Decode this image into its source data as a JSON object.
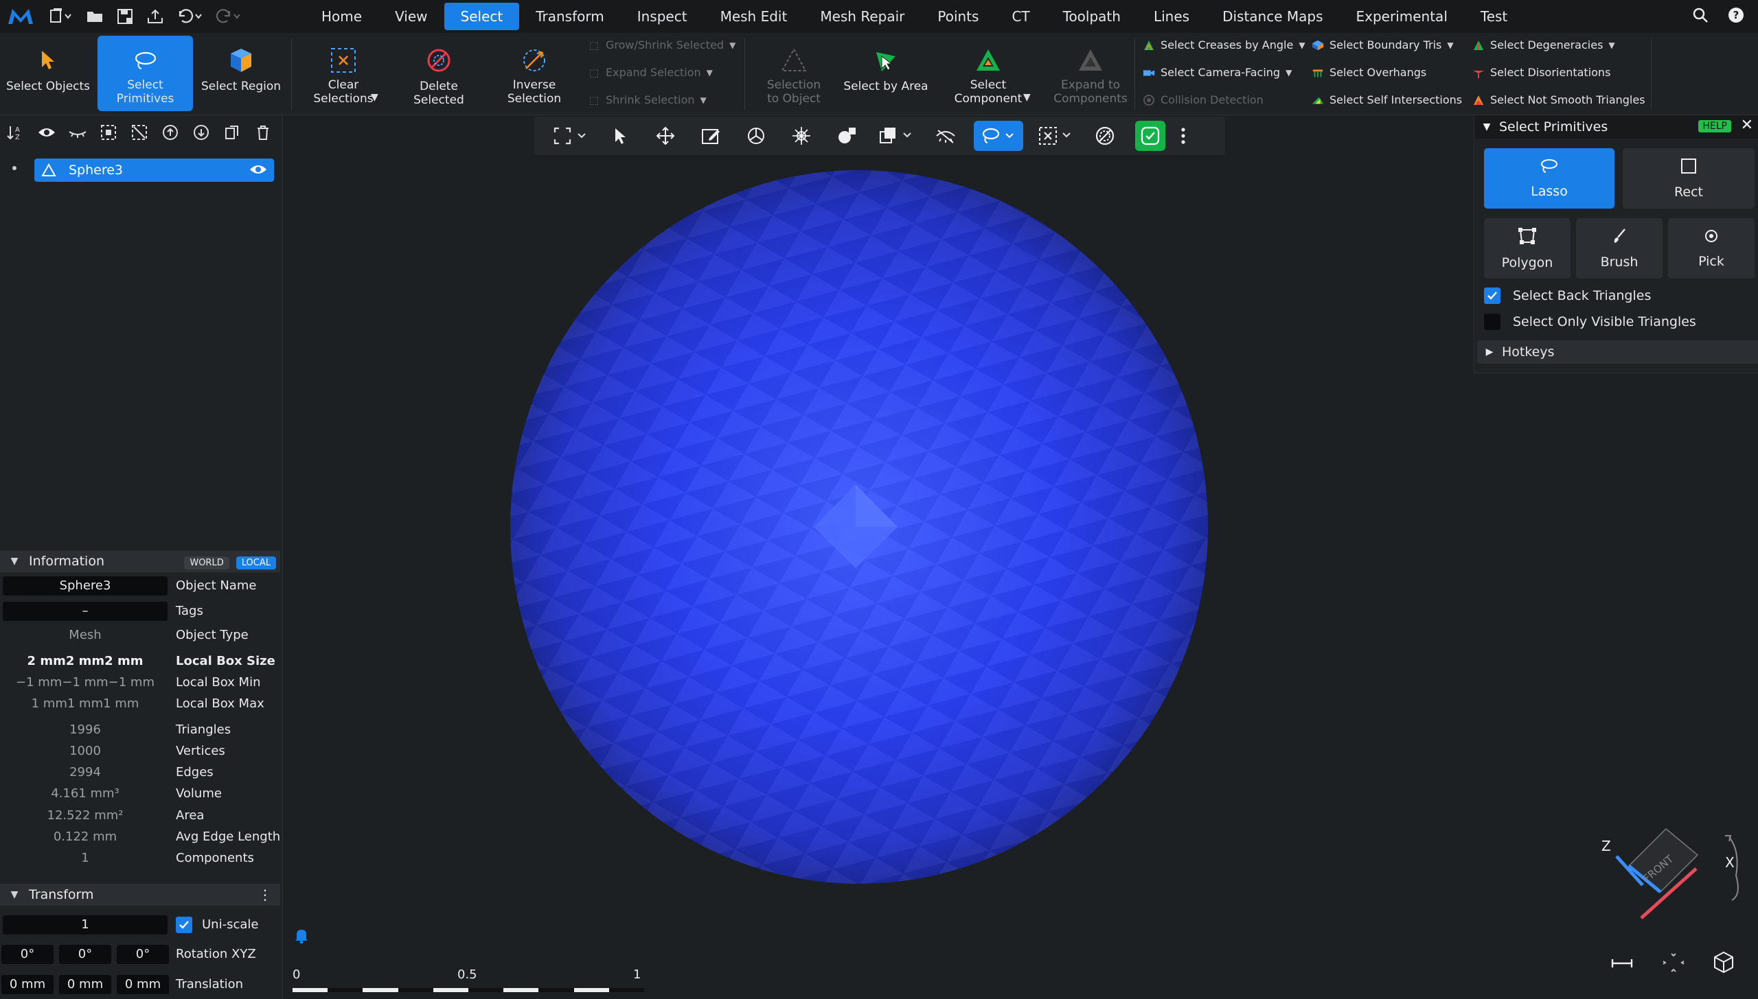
{
  "menu": {
    "tabs": [
      "Home",
      "View",
      "Select",
      "Transform",
      "Inspect",
      "Mesh Edit",
      "Mesh Repair",
      "Points",
      "CT",
      "Toolpath",
      "Lines",
      "Distance Maps",
      "Experimental",
      "Test"
    ],
    "active_tab": "Select"
  },
  "ribbon": {
    "select_objects": "Select Objects",
    "select_primitives": "Select Primitives",
    "select_region": "Select Region",
    "clear_selections": "Clear Selections",
    "delete_selected": "Delete Selected",
    "inverse_selection": "Inverse Selection",
    "grow_shrink": "Grow/Shrink Selected",
    "expand_selection": "Expand Selection",
    "shrink_selection": "Shrink Selection",
    "selection_to_object": "Selection to Object",
    "select_by_area": "Select by Area",
    "select_component": "Select Component",
    "expand_to_components": "Expand to Components",
    "select_creases": "Select Creases by Angle",
    "select_camera_facing": "Select Camera-Facing",
    "collision_detection": "Collision Detection",
    "select_boundary_tris": "Select Boundary Tris",
    "select_overhangs": "Select Overhangs",
    "select_self_intersections": "Select Self Intersections",
    "select_degeneracies": "Select Degeneracies",
    "select_disorientations": "Select Disorientations",
    "select_not_smooth": "Select Not Smooth Triangles"
  },
  "scene_tree": {
    "object_name": "Sphere3"
  },
  "information": {
    "title": "Information",
    "world": "WORLD",
    "local": "LOCAL",
    "object_name_value": "Sphere3",
    "object_name_label": "Object Name",
    "tags_value": "–",
    "tags_label": "Tags",
    "object_type_value": "Mesh",
    "object_type_label": "Object Type",
    "box_size": [
      "2 mm",
      "2 mm",
      "2 mm"
    ],
    "box_size_label": "Local Box Size",
    "box_min": [
      "−1 mm",
      "−1 mm",
      "−1 mm"
    ],
    "box_min_label": "Local Box Min",
    "box_max": [
      "1 mm",
      "1 mm",
      "1 mm"
    ],
    "box_max_label": "Local Box Max",
    "triangles": "1996",
    "triangles_label": "Triangles",
    "vertices": "1000",
    "vertices_label": "Vertices",
    "edges": "2994",
    "edges_label": "Edges",
    "volume": "4.161 mm³",
    "volume_label": "Volume",
    "area": "12.522 mm²",
    "area_label": "Area",
    "avg_edge": "0.122 mm",
    "avg_edge_label": "Avg Edge Length",
    "components": "1",
    "components_label": "Components"
  },
  "transform": {
    "title": "Transform",
    "scale": "1",
    "uniscale_label": "Uni-scale",
    "uniscale_checked": true,
    "rotation": [
      "0°",
      "0°",
      "0°"
    ],
    "rotation_label": "Rotation XYZ",
    "translation": [
      "0 mm",
      "0 mm",
      "0 mm"
    ],
    "translation_label": "Translation"
  },
  "select_primitives_panel": {
    "title": "Select Primitives",
    "help": "HELP",
    "modes": [
      "Lasso",
      "Rect",
      "Polygon",
      "Brush",
      "Pick"
    ],
    "active_mode": "Lasso",
    "select_back_triangles": "Select Back Triangles",
    "select_back_checked": true,
    "select_only_visible": "Select Only Visible Triangles",
    "select_only_visible_checked": false,
    "hotkeys": "Hotkeys"
  },
  "ruler": {
    "ticks": [
      "0",
      "0.5",
      "1"
    ]
  },
  "view_cube": {
    "face": "FRONT",
    "axis_x": "X",
    "axis_z": "Z"
  },
  "colors": {
    "accent": "#1a7fe6",
    "green": "#15b24a",
    "sphere": "#2a3ff0",
    "help_badge": "#22c04a"
  }
}
